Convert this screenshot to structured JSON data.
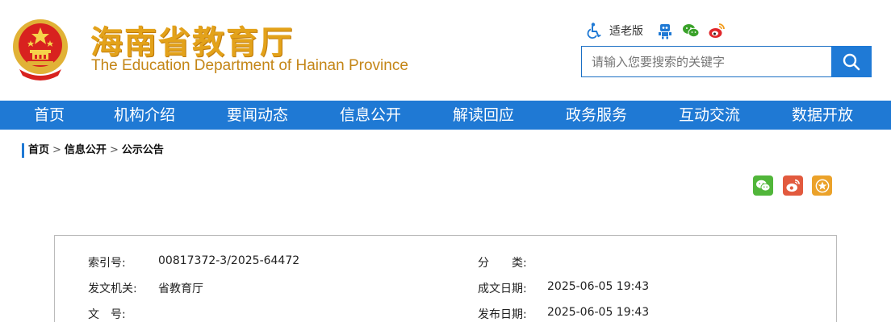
{
  "header": {
    "title_cn": "海南省教育厅",
    "title_en": "The Education Department of Hainan Province",
    "elder_mode_label": "适老版",
    "search": {
      "placeholder": "请输入您要搜索的关键字"
    }
  },
  "nav": {
    "items": [
      "首页",
      "机构介绍",
      "要闻动态",
      "信息公开",
      "解读回应",
      "政务服务",
      "互动交流",
      "数据开放"
    ]
  },
  "breadcrumb": {
    "items": [
      "首页",
      "信息公开",
      "公示公告"
    ],
    "separator": ">"
  },
  "share": {
    "icons": [
      "wechat-icon",
      "weibo-icon",
      "favorite-icon"
    ]
  },
  "info": {
    "index_label": "索引号:",
    "index_value": "00817372-3/2025-64472",
    "category_label": "分　　类:",
    "category_value": "",
    "issuer_label": "发文机关:",
    "issuer_value": "省教育厅",
    "created_label": "成文日期:",
    "created_value": "2025-06-05 19:43",
    "docnum_label": "文　号:",
    "docnum_value": "",
    "published_label": "发布日期:",
    "published_value": "2025-06-05 19:43"
  },
  "colors": {
    "nav_blue": "#1f79d4",
    "title_gold": "#e3a21a",
    "share_wechat": "#51b63a",
    "share_weibo": "#e25a3e",
    "share_fav": "#eba22a"
  }
}
